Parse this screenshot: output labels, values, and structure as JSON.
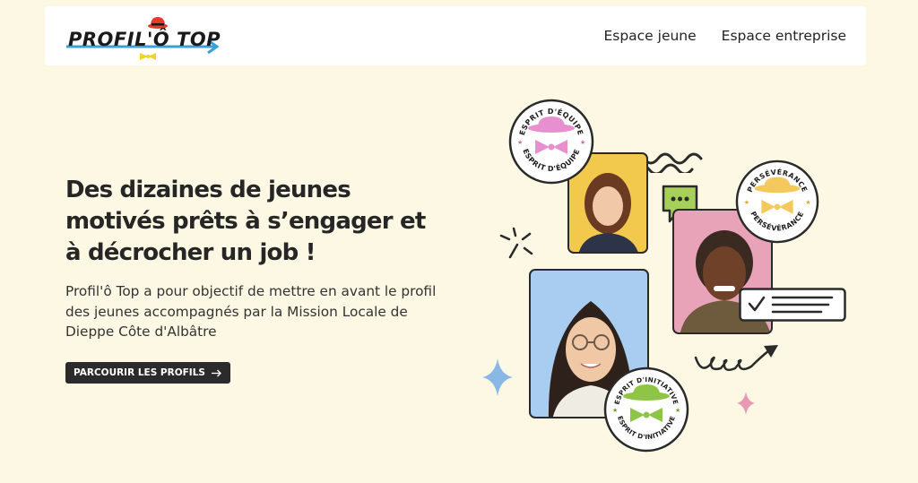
{
  "header": {
    "logo_text": "PROFIL'Ô TOP",
    "nav": [
      "Espace jeune",
      "Espace entreprise"
    ]
  },
  "hero": {
    "title": "Des dizaines de jeunes motivés prêts à s’engager et à décrocher un job !",
    "description": "Profil'ô Top a pour objectif de mettre en avant le profil des jeunes accompagnés par la Mission Locale de Dieppe Côte d'Albâtre",
    "cta_label": "PARCOURIR LES PROFILS",
    "cta_icon": "arrow-right-icon"
  },
  "badges": {
    "equipe": "ESPRIT D'ÉQUIPE",
    "perseverance": "PERSÉVÉRANCE",
    "initiative": "ESPRIT D'INITIATIVE"
  },
  "colors": {
    "background": "#fdf8e3",
    "badge_pink": "#e890cf",
    "badge_yellow": "#f4c95c",
    "badge_green": "#8ec546",
    "photo_yellow": "#f2c94c",
    "photo_pink": "#e9a3b8",
    "photo_blue": "#a9cdf0",
    "logo_red": "#e23b2e",
    "logo_blue": "#3a9fd8"
  }
}
